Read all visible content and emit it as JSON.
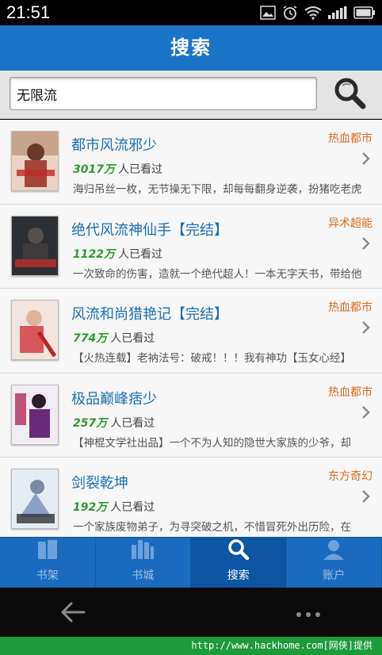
{
  "status": {
    "time": "21:51"
  },
  "header": {
    "title": "搜索"
  },
  "search": {
    "value": "无限流"
  },
  "books": [
    {
      "title": "都市风流邪少",
      "category": "热血都市",
      "count": "3017万",
      "stat_suffix": "人已看过",
      "desc": "海归吊丝一枚，无节操无下限，却每每翻身逆袭，扮猪吃老虎"
    },
    {
      "title": "绝代风流神仙手【完结】",
      "category": "异术超能",
      "count": "1122万",
      "stat_suffix": "人已看过",
      "desc": "一次致命的伤害，造就一个绝代超人！一本无字天书，带给他"
    },
    {
      "title": "风流和尚猎艳记【完结】",
      "category": "热血都市",
      "count": "774万",
      "stat_suffix": "人已看过",
      "desc": "【火热连载】老衲法号：破戒！！！我有神功【玉女心经】"
    },
    {
      "title": "极品巅峰痞少",
      "category": "热血都市",
      "count": "257万",
      "stat_suffix": "人已看过",
      "desc": "【神棍文学社出品】一个不为人知的隐世大家族的少爷，却"
    },
    {
      "title": "剑裂乾坤",
      "category": "东方奇幻",
      "count": "192万",
      "stat_suffix": "人已看过",
      "desc": "一个家族废物弟子，为寻突破之机，不惜冒死外出历险，在"
    }
  ],
  "nav": [
    {
      "label": "书架",
      "icon": "bookshelf-icon"
    },
    {
      "label": "书城",
      "icon": "bookstore-icon"
    },
    {
      "label": "搜索",
      "icon": "search-icon",
      "active": true
    },
    {
      "label": "账户",
      "icon": "account-icon"
    }
  ],
  "footer": {
    "text": "http://www.hackhome.com[网侠]提供"
  },
  "colors": {
    "accent": "#1a74c8",
    "category": "#d86b1c",
    "count": "#2f9a2f",
    "title": "#1b6fb0"
  }
}
